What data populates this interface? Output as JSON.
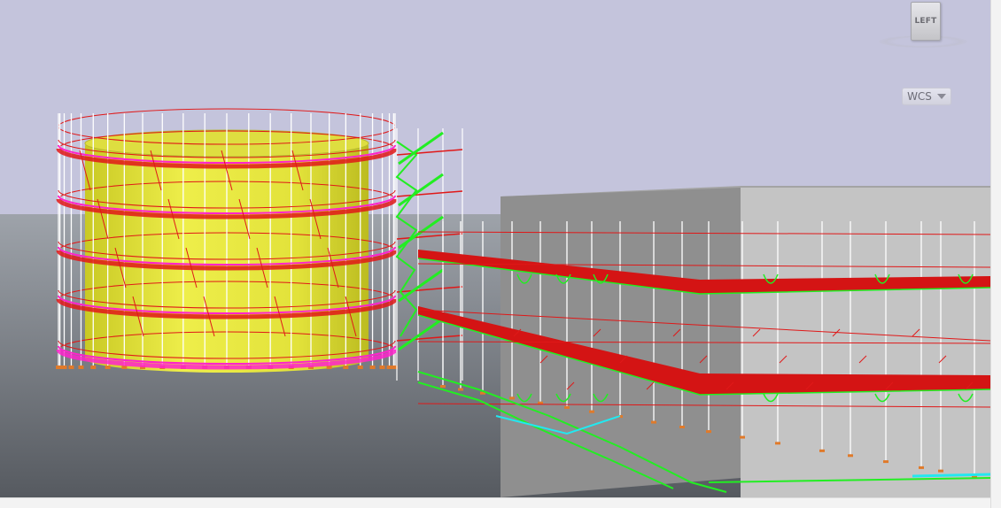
{
  "viewport": {
    "colors": {
      "sky": "#c4c4dc",
      "ground_top": "#9ea3aa",
      "ground_bottom": "#565a60",
      "tank": "#e4e43a",
      "building": "#c4c4c4",
      "scaffold_red": "#e01818",
      "scaffold_green": "#22ee22",
      "scaffold_magenta": "#ff22cc",
      "scaffold_cyan": "#22e8f0",
      "standards": "#ffffff"
    }
  },
  "viewcube": {
    "face_label": "LEFT",
    "icon": "viewcube-icon"
  },
  "coordinate_system": {
    "label": "WCS",
    "icon": "chevron-down-icon"
  }
}
